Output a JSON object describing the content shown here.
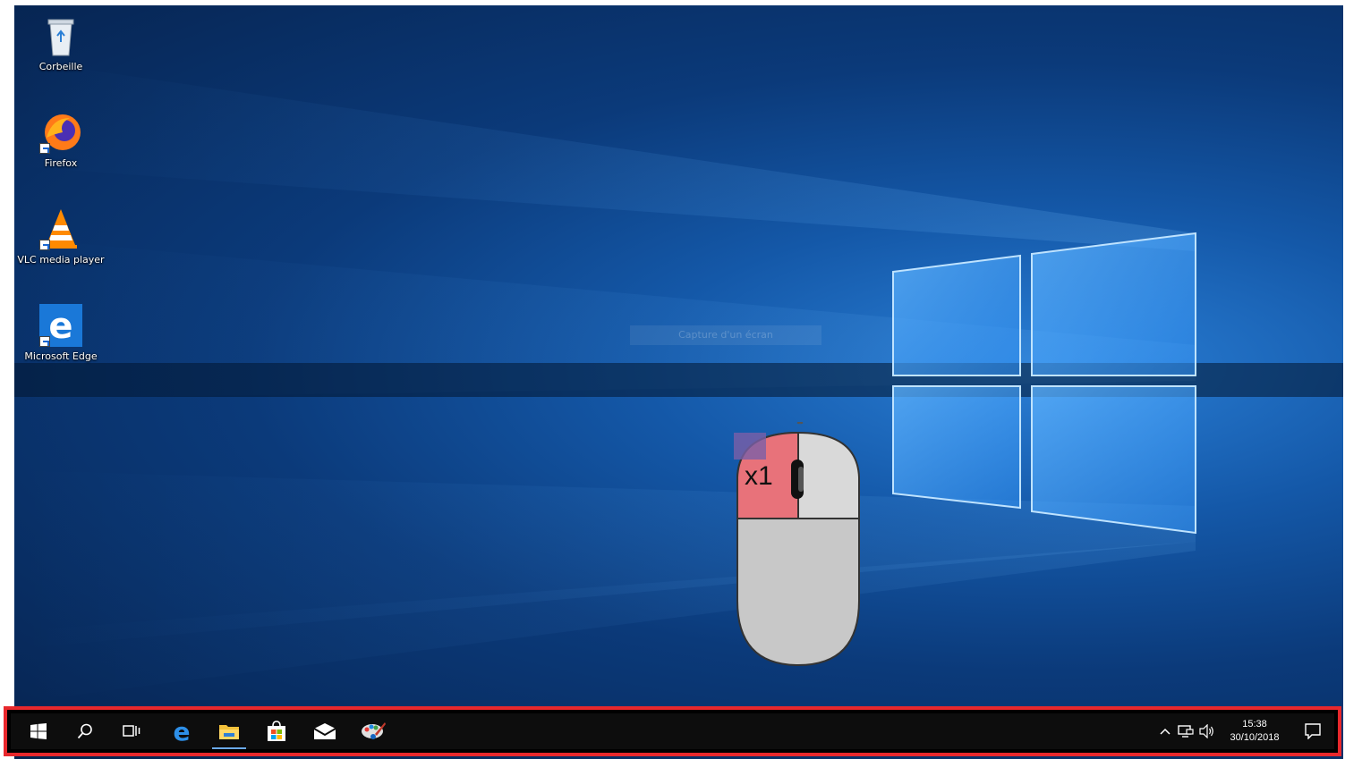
{
  "desktop": {
    "icons": [
      {
        "label": "Corbeille",
        "icon": "recycle-bin-icon"
      },
      {
        "label": "Firefox",
        "icon": "firefox-icon"
      },
      {
        "label": "VLC media player",
        "icon": "vlc-icon"
      },
      {
        "label": "Microsoft Edge",
        "icon": "edge-icon"
      }
    ],
    "capture_hint": "Capture d'un écran"
  },
  "overlay": {
    "click_count": "x1",
    "highlighted_button": "left",
    "highlight_color": "#e8727a"
  },
  "taskbar": {
    "highlight_border_color": "#e8282c",
    "buttons": [
      {
        "icon": "windows-start-icon"
      },
      {
        "icon": "search-icon"
      },
      {
        "icon": "task-view-icon"
      },
      {
        "icon": "edge-icon"
      },
      {
        "icon": "file-explorer-icon",
        "active": true
      },
      {
        "icon": "store-icon"
      },
      {
        "icon": "mail-icon"
      },
      {
        "icon": "paint-icon"
      }
    ],
    "tray": {
      "icons": [
        "chevron-up-icon",
        "network-icon",
        "volume-icon"
      ],
      "time": "15:38",
      "date": "30/10/2018",
      "notification_icon": "action-center-icon"
    }
  }
}
